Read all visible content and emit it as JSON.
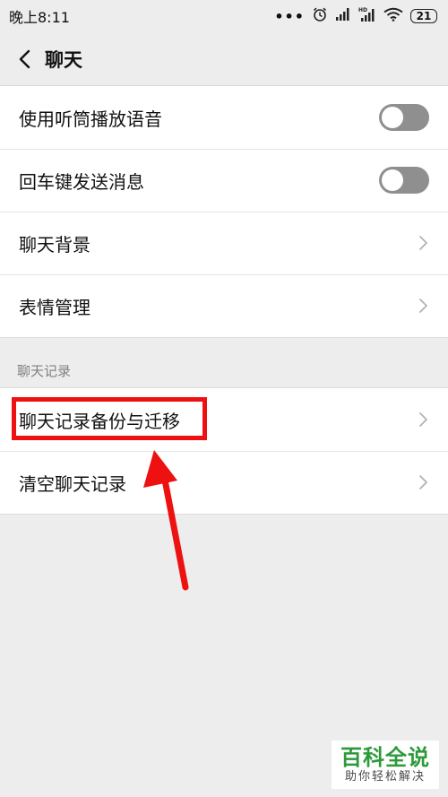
{
  "status_bar": {
    "time": "晚上8:11",
    "dots": "•••",
    "battery": "21",
    "icons": [
      "alarm-icon",
      "signal-icon",
      "signal-hd-icon",
      "wifi-icon",
      "battery-icon"
    ]
  },
  "nav": {
    "title": "聊天",
    "back_icon": "chevron-left-icon"
  },
  "settings_group_1": {
    "items": [
      {
        "label": "使用听筒播放语音",
        "control": "toggle",
        "state": "off"
      },
      {
        "label": "回车键发送消息",
        "control": "toggle",
        "state": "off"
      },
      {
        "label": "聊天背景",
        "control": "chevron"
      },
      {
        "label": "表情管理",
        "control": "chevron"
      }
    ]
  },
  "section_header": "聊天记录",
  "settings_group_2": {
    "items": [
      {
        "label": "聊天记录备份与迁移",
        "control": "chevron"
      },
      {
        "label": "清空聊天记录",
        "control": "chevron"
      }
    ]
  },
  "annotation": {
    "highlight_color": "#ee1111"
  },
  "watermark": {
    "main": "百科全说",
    "sub": "助你轻松解决",
    "color": "#2d9a3a"
  },
  "colors": {
    "background": "#ededed",
    "row_background": "#ffffff",
    "toggle_off": "#8f8f8f"
  }
}
